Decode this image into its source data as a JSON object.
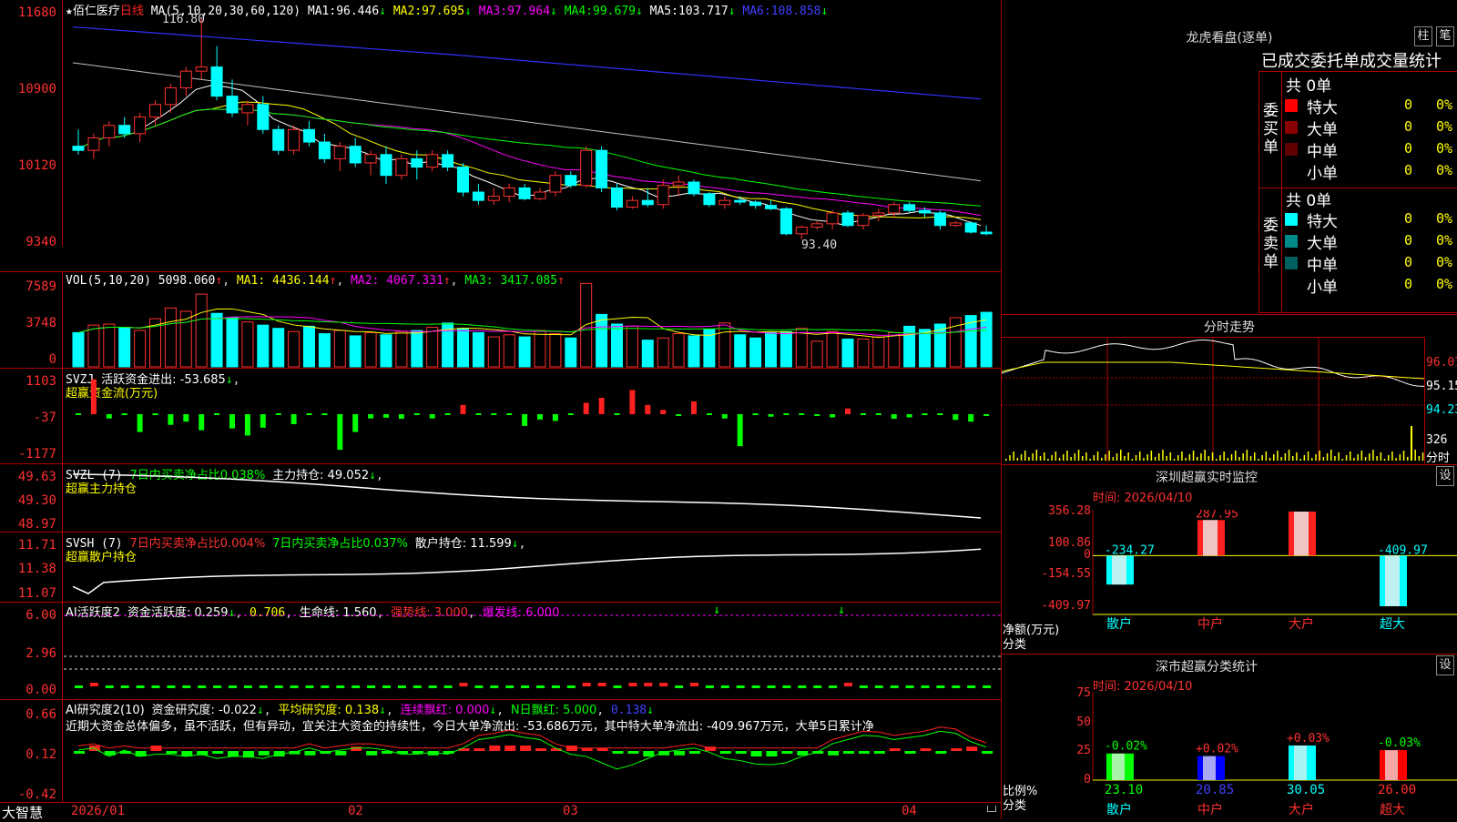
{
  "stock": {
    "star": "★",
    "name": "佰仁医疗",
    "period": "日线"
  },
  "ma": {
    "label": "MA(5,10,20,30,60,120)",
    "items": [
      {
        "name": "MA1:",
        "value": "96.446",
        "arrow": "↓",
        "color": "#ffffff"
      },
      {
        "name": "MA2:",
        "value": "97.695",
        "arrow": "↓",
        "color": "#ffff00"
      },
      {
        "name": "MA3:",
        "value": "97.964",
        "arrow": "↓",
        "color": "#ff00ff"
      },
      {
        "name": "MA4:",
        "value": "99.679",
        "arrow": "↓",
        "color": "#00ff00"
      },
      {
        "name": "MA5:",
        "value": "103.717",
        "arrow": "↓",
        "color": "#c0c0c0"
      },
      {
        "name": "MA6:",
        "value": "108.858",
        "arrow": "↓",
        "color": "#4040ff"
      }
    ]
  },
  "price_axis": [
    "11680",
    "10900",
    "10120",
    "9340"
  ],
  "high_mark": "116.80",
  "low_mark": "93.40",
  "vol": {
    "label": "VOL(5,10,20)",
    "value": "5098.060",
    "ma1": "MA1: 4436.144",
    "ma2": "MA2: 4067.331",
    "ma3": "MA3: 3417.085",
    "arrow1": "↑",
    "arrow2": "↑",
    "arrow3": "↑",
    "axis": [
      "7589",
      "3748",
      "0"
    ]
  },
  "svzj": {
    "label": "SVZJ",
    "title": "活跃资金进出: -53.685",
    "arrow": "↓",
    "sub": "超赢资金流(万元)",
    "axis": [
      "1103",
      "-37",
      "-1177"
    ]
  },
  "svzl": {
    "label": "SVZL (7)",
    "item1": "7日内买卖净占比0.038%",
    "item2": "主力持仓: 49.052",
    "arrow": "↓",
    "sub": "超赢主力持仓",
    "axis": [
      "49.63",
      "49.30",
      "48.97"
    ]
  },
  "svsh": {
    "label": "SVSH (7)",
    "item1": "7日内买卖净占比0.004%",
    "item2": "7日内买卖净占比0.037%",
    "item3": "散户持仓: 11.599",
    "arrow": "↓",
    "sub": "超赢散户持仓",
    "axis": [
      "11.71",
      "11.38",
      "11.07"
    ]
  },
  "ai1": {
    "label": "AI活跃度2",
    "item1": "资金活跃度: 0.259",
    "a1": "↓",
    "item2": "0.706",
    "item3": "生命线: 1.560",
    "item4": "强势线: 3.000",
    "item5": "爆发线: 6.000",
    "axis": [
      "6.00",
      "2.96",
      "0.00"
    ]
  },
  "ai2": {
    "label": "AI研究度2(10)",
    "item1": "资金研究度: -0.022",
    "a1": "↓",
    "item2": "平均研究度: 0.138",
    "a2": "↓",
    "item3": "连续飘红: 0.000",
    "a3": "↓",
    "item4": "N日飘红: 5.000",
    "item5": "0.138",
    "a5": "↓",
    "text": "近期大资金总体偏多，虽不活跃，但有异动，宜关注大资金的持续性，今日大单净流出: -53.686万元，其中特大单净流出: -409.967万元，大单5日累计净",
    "axis": [
      "0.66",
      "0.12",
      "-0.42"
    ]
  },
  "dates": [
    "2026/01",
    "02",
    "03",
    "04"
  ],
  "brand": "大智慧",
  "dragon": {
    "title": "龙虎看盘(逐单)",
    "btn1": "柱",
    "btn2": "笔",
    "subtitle": "已成交委托单成交量统计",
    "buy": {
      "side": "委买单",
      "total": "共 0单",
      "rows": [
        {
          "label": "特大",
          "count": "0",
          "pct": "0%",
          "color": "#ff0000"
        },
        {
          "label": "大单",
          "count": "0",
          "pct": "0%",
          "color": "#8b0000"
        },
        {
          "label": "中单",
          "count": "0",
          "pct": "0%",
          "color": "#600000"
        },
        {
          "label": "小单",
          "count": "0",
          "pct": "0%",
          "color": "#000000"
        }
      ]
    },
    "sell": {
      "side": "委卖单",
      "total": "共 0单",
      "rows": [
        {
          "label": "特大",
          "count": "0",
          "pct": "0%",
          "color": "#00ffff"
        },
        {
          "label": "大单",
          "count": "0",
          "pct": "0%",
          "color": "#008b8b"
        },
        {
          "label": "中单",
          "count": "0",
          "pct": "0%",
          "color": "#006060"
        },
        {
          "label": "小单",
          "count": "0",
          "pct": "0%",
          "color": "#000000"
        }
      ]
    }
  },
  "intraday": {
    "title": "分时走势",
    "axis": [
      "96.07",
      "95.15",
      "94.23"
    ],
    "vol": "326",
    "vollabel": "分时"
  },
  "sz_monitor": {
    "title": "深圳超赢实时监控",
    "btn": "设",
    "date": "时间: 2026/04/10",
    "axis": [
      "356.28",
      "100.86",
      "0",
      "-154.55",
      "-409.97"
    ],
    "ylabel": "净额(万元)",
    "xlabel": "分类",
    "bars": [
      {
        "cat": "散户",
        "value": -234.27,
        "label": "-234.27"
      },
      {
        "cat": "中户",
        "value": 287.95,
        "label": "287.95"
      },
      {
        "cat": "大户",
        "value": 356.28,
        "label": "356.28"
      },
      {
        "cat": "超大",
        "value": -409.97,
        "label": "-409.97"
      }
    ]
  },
  "sz_class": {
    "title": "深市超赢分类统计",
    "btn": "设",
    "date": "时间: 2026/04/10",
    "axis": [
      "75",
      "50",
      "25",
      "0"
    ],
    "ylabel": "比例%",
    "xlabel": "分类",
    "bars": [
      {
        "cat": "散户",
        "value": 23.1,
        "label": "23.10",
        "chg": "-0.02%",
        "color": "#00ff00"
      },
      {
        "cat": "中户",
        "value": 20.85,
        "label": "20.85",
        "chg": "+0.02%",
        "color": "#0000ff"
      },
      {
        "cat": "大户",
        "value": 30.05,
        "label": "30.05",
        "chg": "+0.03%",
        "color": "#00ffff"
      },
      {
        "cat": "超大",
        "value": 26.0,
        "label": "26.00",
        "chg": "-0.03%",
        "color": "#ff0000"
      }
    ]
  },
  "chart_data": {
    "type": "candlestick",
    "title": "佰仁医疗 日线",
    "ylim": [
      93.4,
      116.8
    ],
    "ohlc": [
      [
        101.5,
        103.5,
        100.5,
        101.0
      ],
      [
        101.0,
        103.0,
        100.0,
        102.5
      ],
      [
        102.5,
        104.5,
        101.5,
        104.0
      ],
      [
        104.0,
        105.0,
        102.5,
        103.0
      ],
      [
        103.0,
        105.5,
        102.0,
        105.0
      ],
      [
        105.0,
        107.0,
        104.0,
        106.5
      ],
      [
        106.5,
        109.0,
        105.5,
        108.5
      ],
      [
        108.5,
        111.0,
        107.5,
        110.5
      ],
      [
        110.5,
        116.8,
        109.5,
        111.0
      ],
      [
        111.0,
        113.5,
        107.0,
        107.5
      ],
      [
        107.5,
        109.5,
        105.0,
        105.5
      ],
      [
        105.5,
        107.0,
        104.0,
        106.5
      ],
      [
        106.5,
        107.5,
        103.0,
        103.5
      ],
      [
        103.5,
        104.0,
        100.5,
        101.0
      ],
      [
        101.0,
        104.0,
        100.5,
        103.5
      ],
      [
        103.5,
        104.5,
        101.5,
        102.0
      ],
      [
        102.0,
        103.0,
        99.5,
        100.0
      ],
      [
        100.0,
        102.0,
        98.5,
        101.5
      ],
      [
        101.5,
        102.5,
        99.0,
        99.5
      ],
      [
        99.5,
        101.0,
        98.0,
        100.5
      ],
      [
        100.5,
        101.5,
        97.0,
        98.0
      ],
      [
        98.0,
        100.5,
        97.5,
        100.0
      ],
      [
        100.0,
        101.0,
        97.5,
        99.0
      ],
      [
        99.0,
        101.0,
        98.5,
        100.5
      ],
      [
        100.5,
        101.0,
        98.5,
        99.0
      ],
      [
        99.0,
        99.5,
        95.5,
        96.0
      ],
      [
        96.0,
        97.0,
        94.5,
        95.0
      ],
      [
        95.0,
        96.5,
        94.5,
        95.5
      ],
      [
        95.5,
        97.0,
        94.8,
        96.5
      ],
      [
        96.5,
        97.0,
        95.0,
        95.2
      ],
      [
        95.2,
        96.5,
        95.0,
        96.0
      ],
      [
        96.0,
        98.5,
        95.5,
        98.0
      ],
      [
        98.0,
        98.5,
        96.5,
        96.8
      ],
      [
        96.8,
        101.5,
        96.5,
        101.0
      ],
      [
        101.0,
        101.5,
        96.0,
        96.5
      ],
      [
        96.5,
        97.0,
        93.8,
        94.2
      ],
      [
        94.2,
        95.5,
        94.0,
        95.0
      ],
      [
        95.0,
        96.5,
        94.2,
        94.5
      ],
      [
        94.5,
        97.5,
        94.0,
        96.8
      ],
      [
        96.8,
        98.0,
        95.5,
        97.2
      ],
      [
        97.2,
        97.5,
        95.5,
        95.8
      ],
      [
        95.8,
        96.0,
        94.2,
        94.5
      ],
      [
        94.5,
        95.5,
        94.0,
        95.0
      ],
      [
        95.0,
        95.5,
        94.5,
        94.8
      ],
      [
        94.8,
        95.0,
        94.0,
        94.4
      ],
      [
        94.4,
        95.0,
        93.8,
        94.0
      ],
      [
        94.0,
        94.2,
        90.8,
        91.0
      ],
      [
        91.0,
        92.0,
        90.3,
        91.8
      ],
      [
        91.8,
        92.5,
        91.5,
        92.2
      ],
      [
        92.2,
        93.8,
        91.5,
        93.5
      ],
      [
        93.5,
        93.8,
        91.8,
        92.0
      ],
      [
        92.0,
        93.5,
        91.5,
        93.2
      ],
      [
        93.2,
        94.0,
        92.5,
        93.5
      ],
      [
        93.5,
        94.8,
        93.0,
        94.5
      ],
      [
        94.5,
        94.8,
        93.5,
        93.8
      ],
      [
        93.8,
        94.2,
        93.0,
        93.5
      ],
      [
        93.5,
        93.8,
        91.5,
        92.0
      ],
      [
        92.0,
        92.5,
        91.8,
        92.3
      ],
      [
        92.3,
        92.5,
        91.0,
        91.2
      ],
      [
        91.2,
        92.0,
        90.8,
        91.0
      ]
    ]
  }
}
